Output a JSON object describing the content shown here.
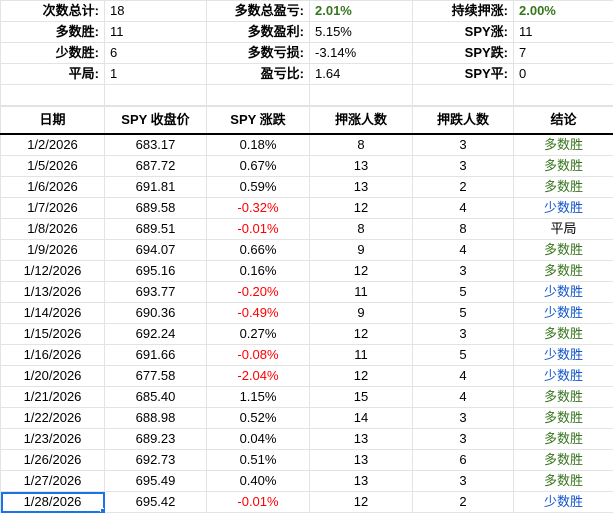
{
  "summary": [
    [
      "次数总计:",
      "18",
      "多数总盈亏:",
      "2.01%",
      "持续押涨:",
      "2.00%"
    ],
    [
      "多数胜:",
      "11",
      "多数盈利:",
      "5.15%",
      "SPY涨:",
      "11"
    ],
    [
      "少数胜:",
      "6",
      "多数亏损:",
      "-3.14%",
      "SPY跌:",
      "7"
    ],
    [
      "平局:",
      "1",
      "盈亏比:",
      "1.64",
      "SPY平:",
      "0"
    ]
  ],
  "headers": [
    "日期",
    "SPY 收盘价",
    "SPY 涨跌",
    "押涨人数",
    "押跌人数",
    "结论"
  ],
  "rows": [
    [
      "1/2/2026",
      "683.17",
      "0.18%",
      "8",
      "3",
      "多数胜"
    ],
    [
      "1/5/2026",
      "687.72",
      "0.67%",
      "13",
      "3",
      "多数胜"
    ],
    [
      "1/6/2026",
      "691.81",
      "0.59%",
      "13",
      "2",
      "多数胜"
    ],
    [
      "1/7/2026",
      "689.58",
      "-0.32%",
      "12",
      "4",
      "少数胜"
    ],
    [
      "1/8/2026",
      "689.51",
      "-0.01%",
      "8",
      "8",
      "平局"
    ],
    [
      "1/9/2026",
      "694.07",
      "0.66%",
      "9",
      "4",
      "多数胜"
    ],
    [
      "1/12/2026",
      "695.16",
      "0.16%",
      "12",
      "3",
      "多数胜"
    ],
    [
      "1/13/2026",
      "693.77",
      "-0.20%",
      "11",
      "5",
      "少数胜"
    ],
    [
      "1/14/2026",
      "690.36",
      "-0.49%",
      "9",
      "5",
      "少数胜"
    ],
    [
      "1/15/2026",
      "692.24",
      "0.27%",
      "12",
      "3",
      "多数胜"
    ],
    [
      "1/16/2026",
      "691.66",
      "-0.08%",
      "11",
      "5",
      "少数胜"
    ],
    [
      "1/20/2026",
      "677.58",
      "-2.04%",
      "12",
      "4",
      "少数胜"
    ],
    [
      "1/21/2026",
      "685.40",
      "1.15%",
      "15",
      "4",
      "多数胜"
    ],
    [
      "1/22/2026",
      "688.98",
      "0.52%",
      "14",
      "3",
      "多数胜"
    ],
    [
      "1/23/2026",
      "689.23",
      "0.04%",
      "13",
      "3",
      "多数胜"
    ],
    [
      "1/26/2026",
      "692.73",
      "0.51%",
      "13",
      "6",
      "多数胜"
    ],
    [
      "1/27/2026",
      "695.49",
      "0.40%",
      "13",
      "3",
      "多数胜"
    ],
    [
      "1/28/2026",
      "695.42",
      "-0.01%",
      "12",
      "2",
      "少数胜"
    ]
  ],
  "colors": {
    "win": "#38761d",
    "lose": "#1155cc",
    "neg": "#ff0000",
    "selection": "#1a73e8"
  }
}
